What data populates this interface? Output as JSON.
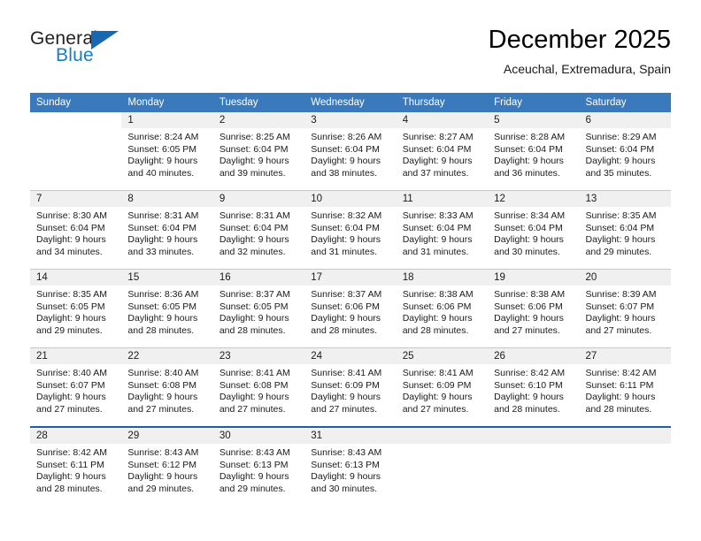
{
  "brand": {
    "name_top": "General",
    "name_bottom": "Blue",
    "accent_color": "#1668b0",
    "text_color": "#231f20"
  },
  "header": {
    "title": "December 2025",
    "location": "Aceuchal, Extremadura, Spain"
  },
  "theme": {
    "header_row_bg": "#3b79bd",
    "header_row_text": "#ffffff",
    "daynum_band_bg": "#f0f0f0",
    "row_divider": "#c8c8c8",
    "last_row_divider": "#1f5fa0"
  },
  "weekdays": [
    "Sunday",
    "Monday",
    "Tuesday",
    "Wednesday",
    "Thursday",
    "Friday",
    "Saturday"
  ],
  "labels": {
    "sunrise_prefix": "Sunrise:",
    "sunset_prefix": "Sunset:",
    "daylight_prefix": "Daylight:"
  },
  "weeks": [
    [
      {
        "day": "",
        "sunrise": "",
        "sunset": "",
        "daylight_line1": "",
        "daylight_line2": ""
      },
      {
        "day": "1",
        "sunrise": "Sunrise: 8:24 AM",
        "sunset": "Sunset: 6:05 PM",
        "daylight_line1": "Daylight: 9 hours",
        "daylight_line2": "and 40 minutes."
      },
      {
        "day": "2",
        "sunrise": "Sunrise: 8:25 AM",
        "sunset": "Sunset: 6:04 PM",
        "daylight_line1": "Daylight: 9 hours",
        "daylight_line2": "and 39 minutes."
      },
      {
        "day": "3",
        "sunrise": "Sunrise: 8:26 AM",
        "sunset": "Sunset: 6:04 PM",
        "daylight_line1": "Daylight: 9 hours",
        "daylight_line2": "and 38 minutes."
      },
      {
        "day": "4",
        "sunrise": "Sunrise: 8:27 AM",
        "sunset": "Sunset: 6:04 PM",
        "daylight_line1": "Daylight: 9 hours",
        "daylight_line2": "and 37 minutes."
      },
      {
        "day": "5",
        "sunrise": "Sunrise: 8:28 AM",
        "sunset": "Sunset: 6:04 PM",
        "daylight_line1": "Daylight: 9 hours",
        "daylight_line2": "and 36 minutes."
      },
      {
        "day": "6",
        "sunrise": "Sunrise: 8:29 AM",
        "sunset": "Sunset: 6:04 PM",
        "daylight_line1": "Daylight: 9 hours",
        "daylight_line2": "and 35 minutes."
      }
    ],
    [
      {
        "day": "7",
        "sunrise": "Sunrise: 8:30 AM",
        "sunset": "Sunset: 6:04 PM",
        "daylight_line1": "Daylight: 9 hours",
        "daylight_line2": "and 34 minutes."
      },
      {
        "day": "8",
        "sunrise": "Sunrise: 8:31 AM",
        "sunset": "Sunset: 6:04 PM",
        "daylight_line1": "Daylight: 9 hours",
        "daylight_line2": "and 33 minutes."
      },
      {
        "day": "9",
        "sunrise": "Sunrise: 8:31 AM",
        "sunset": "Sunset: 6:04 PM",
        "daylight_line1": "Daylight: 9 hours",
        "daylight_line2": "and 32 minutes."
      },
      {
        "day": "10",
        "sunrise": "Sunrise: 8:32 AM",
        "sunset": "Sunset: 6:04 PM",
        "daylight_line1": "Daylight: 9 hours",
        "daylight_line2": "and 31 minutes."
      },
      {
        "day": "11",
        "sunrise": "Sunrise: 8:33 AM",
        "sunset": "Sunset: 6:04 PM",
        "daylight_line1": "Daylight: 9 hours",
        "daylight_line2": "and 31 minutes."
      },
      {
        "day": "12",
        "sunrise": "Sunrise: 8:34 AM",
        "sunset": "Sunset: 6:04 PM",
        "daylight_line1": "Daylight: 9 hours",
        "daylight_line2": "and 30 minutes."
      },
      {
        "day": "13",
        "sunrise": "Sunrise: 8:35 AM",
        "sunset": "Sunset: 6:04 PM",
        "daylight_line1": "Daylight: 9 hours",
        "daylight_line2": "and 29 minutes."
      }
    ],
    [
      {
        "day": "14",
        "sunrise": "Sunrise: 8:35 AM",
        "sunset": "Sunset: 6:05 PM",
        "daylight_line1": "Daylight: 9 hours",
        "daylight_line2": "and 29 minutes."
      },
      {
        "day": "15",
        "sunrise": "Sunrise: 8:36 AM",
        "sunset": "Sunset: 6:05 PM",
        "daylight_line1": "Daylight: 9 hours",
        "daylight_line2": "and 28 minutes."
      },
      {
        "day": "16",
        "sunrise": "Sunrise: 8:37 AM",
        "sunset": "Sunset: 6:05 PM",
        "daylight_line1": "Daylight: 9 hours",
        "daylight_line2": "and 28 minutes."
      },
      {
        "day": "17",
        "sunrise": "Sunrise: 8:37 AM",
        "sunset": "Sunset: 6:06 PM",
        "daylight_line1": "Daylight: 9 hours",
        "daylight_line2": "and 28 minutes."
      },
      {
        "day": "18",
        "sunrise": "Sunrise: 8:38 AM",
        "sunset": "Sunset: 6:06 PM",
        "daylight_line1": "Daylight: 9 hours",
        "daylight_line2": "and 28 minutes."
      },
      {
        "day": "19",
        "sunrise": "Sunrise: 8:38 AM",
        "sunset": "Sunset: 6:06 PM",
        "daylight_line1": "Daylight: 9 hours",
        "daylight_line2": "and 27 minutes."
      },
      {
        "day": "20",
        "sunrise": "Sunrise: 8:39 AM",
        "sunset": "Sunset: 6:07 PM",
        "daylight_line1": "Daylight: 9 hours",
        "daylight_line2": "and 27 minutes."
      }
    ],
    [
      {
        "day": "21",
        "sunrise": "Sunrise: 8:40 AM",
        "sunset": "Sunset: 6:07 PM",
        "daylight_line1": "Daylight: 9 hours",
        "daylight_line2": "and 27 minutes."
      },
      {
        "day": "22",
        "sunrise": "Sunrise: 8:40 AM",
        "sunset": "Sunset: 6:08 PM",
        "daylight_line1": "Daylight: 9 hours",
        "daylight_line2": "and 27 minutes."
      },
      {
        "day": "23",
        "sunrise": "Sunrise: 8:41 AM",
        "sunset": "Sunset: 6:08 PM",
        "daylight_line1": "Daylight: 9 hours",
        "daylight_line2": "and 27 minutes."
      },
      {
        "day": "24",
        "sunrise": "Sunrise: 8:41 AM",
        "sunset": "Sunset: 6:09 PM",
        "daylight_line1": "Daylight: 9 hours",
        "daylight_line2": "and 27 minutes."
      },
      {
        "day": "25",
        "sunrise": "Sunrise: 8:41 AM",
        "sunset": "Sunset: 6:09 PM",
        "daylight_line1": "Daylight: 9 hours",
        "daylight_line2": "and 27 minutes."
      },
      {
        "day": "26",
        "sunrise": "Sunrise: 8:42 AM",
        "sunset": "Sunset: 6:10 PM",
        "daylight_line1": "Daylight: 9 hours",
        "daylight_line2": "and 28 minutes."
      },
      {
        "day": "27",
        "sunrise": "Sunrise: 8:42 AM",
        "sunset": "Sunset: 6:11 PM",
        "daylight_line1": "Daylight: 9 hours",
        "daylight_line2": "and 28 minutes."
      }
    ],
    [
      {
        "day": "28",
        "sunrise": "Sunrise: 8:42 AM",
        "sunset": "Sunset: 6:11 PM",
        "daylight_line1": "Daylight: 9 hours",
        "daylight_line2": "and 28 minutes."
      },
      {
        "day": "29",
        "sunrise": "Sunrise: 8:43 AM",
        "sunset": "Sunset: 6:12 PM",
        "daylight_line1": "Daylight: 9 hours",
        "daylight_line2": "and 29 minutes."
      },
      {
        "day": "30",
        "sunrise": "Sunrise: 8:43 AM",
        "sunset": "Sunset: 6:13 PM",
        "daylight_line1": "Daylight: 9 hours",
        "daylight_line2": "and 29 minutes."
      },
      {
        "day": "31",
        "sunrise": "Sunrise: 8:43 AM",
        "sunset": "Sunset: 6:13 PM",
        "daylight_line1": "Daylight: 9 hours",
        "daylight_line2": "and 30 minutes."
      },
      {
        "day": "",
        "sunrise": "",
        "sunset": "",
        "daylight_line1": "",
        "daylight_line2": ""
      },
      {
        "day": "",
        "sunrise": "",
        "sunset": "",
        "daylight_line1": "",
        "daylight_line2": ""
      },
      {
        "day": "",
        "sunrise": "",
        "sunset": "",
        "daylight_line1": "",
        "daylight_line2": ""
      }
    ]
  ]
}
